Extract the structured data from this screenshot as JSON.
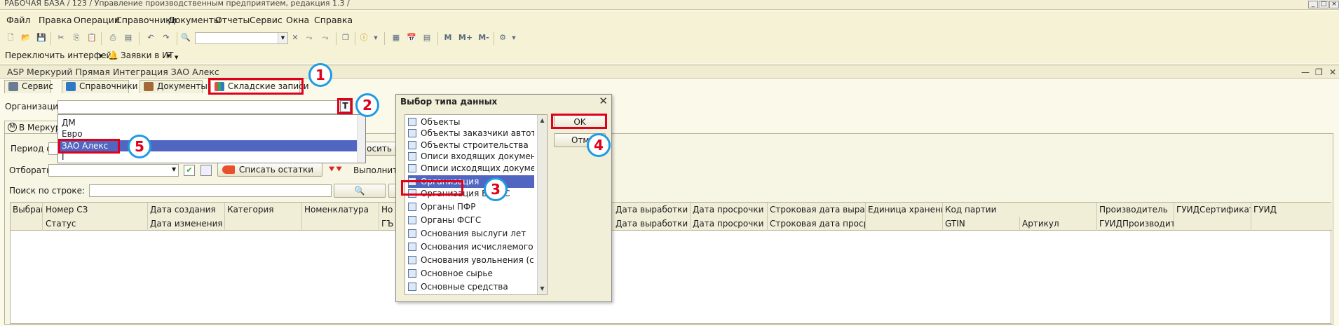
{
  "title": "РАБОЧАЯ БАЗА / 123 / Управление производственным предприятием, редакция 1.3 /",
  "menu": [
    "Файл",
    "Правка",
    "Операции",
    "Справочники",
    "Документы",
    "Отчеты",
    "Сервис",
    "Окна",
    "Справка"
  ],
  "switchbar": {
    "interface": "Переключить интерфейс",
    "requests": "Заявки в ИТ"
  },
  "window": {
    "title": "ASP Меркурий Прямая Интеграция ЗАО Алекс"
  },
  "tabs": [
    "Сервис",
    "Справочники",
    "Документы",
    "Складские записи"
  ],
  "org": {
    "label": "Организация:",
    "type_button": "T"
  },
  "dropdown": {
    "items": [
      "ДМ",
      "Евро",
      "ЗАО Алекс",
      "І"
    ]
  },
  "subtab": "В Меркур",
  "filters": {
    "period_label": "Период с:",
    "partial_btn": "осить в",
    "select_label": "Отборать:",
    "write_off": "Списать остатки",
    "execute": "Выполнить",
    "search_label": "Поиск по строке:"
  },
  "grid": {
    "row1": [
      "Выбран",
      "Номер СЗ",
      "Дата создания",
      "Категория",
      "Номенклатура",
      "Но",
      "Дата выработки",
      "Дата просрочки",
      "Строковая дата выработ...",
      "Единица хранения",
      "Код партии",
      "Производитель",
      "ГУИДСертификата",
      "ГУИД"
    ],
    "row2": [
      "Статус",
      "Дата изменения",
      "ГЪ",
      "Дата выработки к...",
      "Дата просрочки к...",
      "Строковая дата просроч...",
      "GTIN",
      "Артикул",
      "ГУИДПроизводит..."
    ]
  },
  "dialog": {
    "title": "Выбор типа данных",
    "close": "✕",
    "ok": "OK",
    "cancel": "Отме",
    "items": [
      "Объекты",
      "Объекты заказчики автотран...",
      "Объекты строительства",
      "Описи входящих документов, ...",
      "Описи исходящих документов...",
      "Организация",
      "Организация ЕГАИС",
      "Органы ПФР",
      "Органы ФСГС",
      "Основания выслуги лет",
      "Основания исчисляемого тру...",
      "Основания увольнения (стать...",
      "Основное сырье",
      "Основные средства"
    ]
  },
  "annotations": [
    "1",
    "2",
    "3",
    "4",
    "5"
  ],
  "colors": {
    "highlight": "#e0001b",
    "badge_ring": "#1e9be5",
    "selection": "#5066c0"
  }
}
